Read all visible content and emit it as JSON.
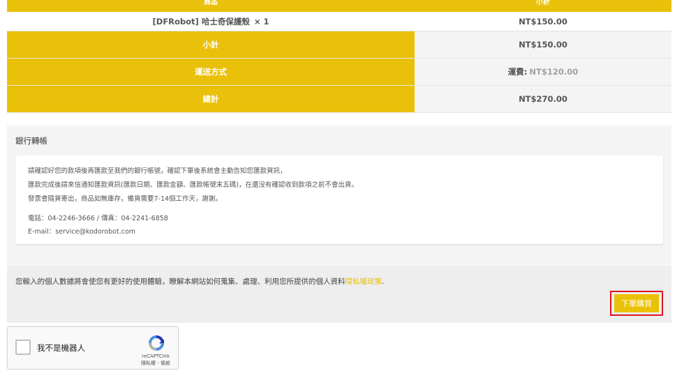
{
  "order": {
    "header": {
      "col1": "商品",
      "col2": "小計"
    },
    "item": {
      "name": "[DFRobot] 哈士奇保護殼",
      "qty": "× 1",
      "subtotal": "NT$150.00"
    },
    "subtotal": {
      "label": "小計",
      "value": "NT$150.00"
    },
    "shipping": {
      "label": "運送方式",
      "fee_label": "運費:",
      "fee_value": "NT$120.00"
    },
    "total": {
      "label": "總計",
      "value": "NT$270.00"
    }
  },
  "bank": {
    "title": "銀行轉帳",
    "lines": [
      "請確認好您的款項後再匯款至我們的銀行帳號，確認下單後系統會主動告知您匯款資訊，",
      "匯款完成後請來信通知匯款資訊(匯款日期、匯款金額、匯款帳號末五碼)，在還沒有確認收到款項之前不會出貨。",
      "發票會隨貨寄出，商品如無庫存，備貨需要7-14個工作天，謝謝。",
      "電話：04-2246-3666 / 傳真：04-2241-6858",
      "E-mail：service@kodorobot.com"
    ]
  },
  "privacy": {
    "text": "您輸入的個人數據將會使您有更好的使用體驗，瞭解本網站如何蒐集、處理、利用您所提供的個人資料",
    "link": "隱私權政策",
    "period": "."
  },
  "submit": {
    "label": "下單購買"
  },
  "recaptcha": {
    "label": "我不是機器人",
    "brand": "reCAPTCHA",
    "terms": "隱私權 - 條款"
  },
  "colors": {
    "accent": "#eac10a",
    "highlight_border": "#e0141e"
  }
}
